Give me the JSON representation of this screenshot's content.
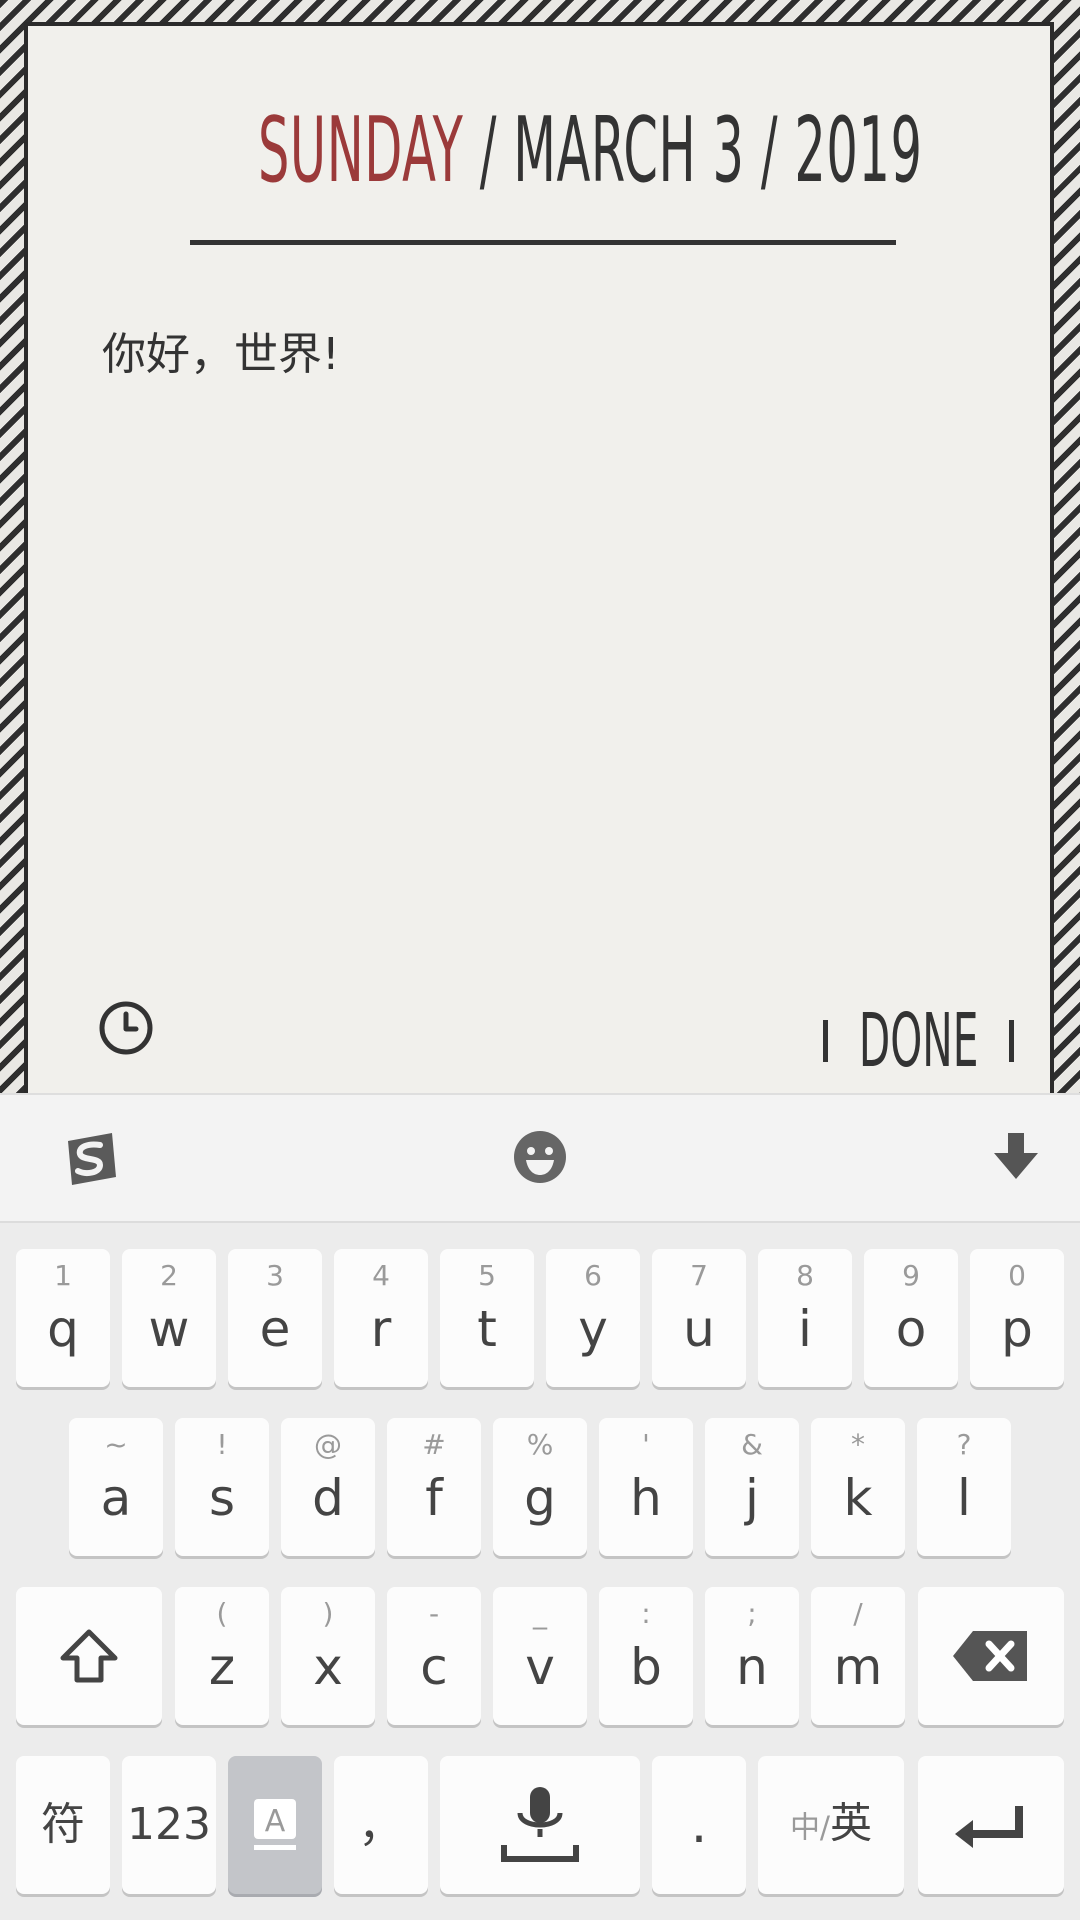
{
  "note": {
    "date_day": "SUNDAY",
    "date_rest": "/ MARCH 3 / 2019",
    "body": "你好，世界!",
    "done_label": "DONE",
    "icons": {
      "clock": "clock-icon"
    },
    "colors": {
      "day": "#9b3a3a",
      "text": "#333333",
      "paper": "#f1f0ec"
    }
  },
  "keyboard": {
    "toolbar": {
      "logo": "sogou-logo-icon",
      "emoji": "emoji-icon",
      "hide": "hide-keyboard-icon"
    },
    "row1": [
      {
        "sub": "1",
        "main": "q"
      },
      {
        "sub": "2",
        "main": "w"
      },
      {
        "sub": "3",
        "main": "e"
      },
      {
        "sub": "4",
        "main": "r"
      },
      {
        "sub": "5",
        "main": "t"
      },
      {
        "sub": "6",
        "main": "y"
      },
      {
        "sub": "7",
        "main": "u"
      },
      {
        "sub": "8",
        "main": "i"
      },
      {
        "sub": "9",
        "main": "o"
      },
      {
        "sub": "0",
        "main": "p"
      }
    ],
    "row2": [
      {
        "sub": "~",
        "main": "a"
      },
      {
        "sub": "!",
        "main": "s"
      },
      {
        "sub": "@",
        "main": "d"
      },
      {
        "sub": "#",
        "main": "f"
      },
      {
        "sub": "%",
        "main": "g"
      },
      {
        "sub": "'",
        "main": "h"
      },
      {
        "sub": "&",
        "main": "j"
      },
      {
        "sub": "*",
        "main": "k"
      },
      {
        "sub": "?",
        "main": "l"
      }
    ],
    "row3": [
      {
        "sub": "(",
        "main": "z"
      },
      {
        "sub": ")",
        "main": "x"
      },
      {
        "sub": "-",
        "main": "c"
      },
      {
        "sub": "_",
        "main": "v"
      },
      {
        "sub": ":",
        "main": "b"
      },
      {
        "sub": ";",
        "main": "n"
      },
      {
        "sub": "/",
        "main": "m"
      }
    ],
    "bottom": {
      "symbols": "符",
      "numbers": "123",
      "comma": "，",
      "period": ".",
      "lang_small": "中/",
      "lang_big": "英"
    }
  }
}
